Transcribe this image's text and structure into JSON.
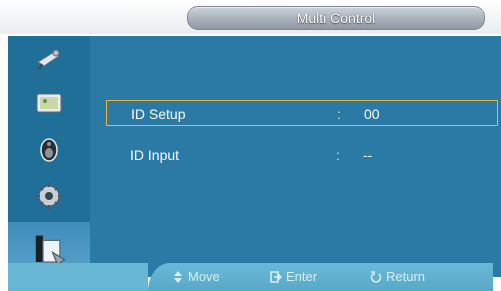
{
  "window": {
    "title": "Multi Control"
  },
  "sidebar": {
    "items": [
      {
        "name": "picture-icon",
        "active": false
      },
      {
        "name": "screen-icon",
        "active": false
      },
      {
        "name": "sound-icon",
        "active": false
      },
      {
        "name": "setup-icon",
        "active": false
      },
      {
        "name": "multi-control-icon",
        "active": true
      }
    ]
  },
  "menu": {
    "items": [
      {
        "label": "ID Setup",
        "separator": ":",
        "value": "00",
        "selected": true
      },
      {
        "label": "ID Input",
        "separator": ":",
        "value": "--",
        "selected": false
      }
    ]
  },
  "help": {
    "move": "Move",
    "enter": "Enter",
    "return": "Return"
  },
  "colors": {
    "panel": "#2b7aa6",
    "sidebar": "#1f6f99",
    "selection_border": "#e9b63c",
    "help_bar": "#67b6d4"
  }
}
